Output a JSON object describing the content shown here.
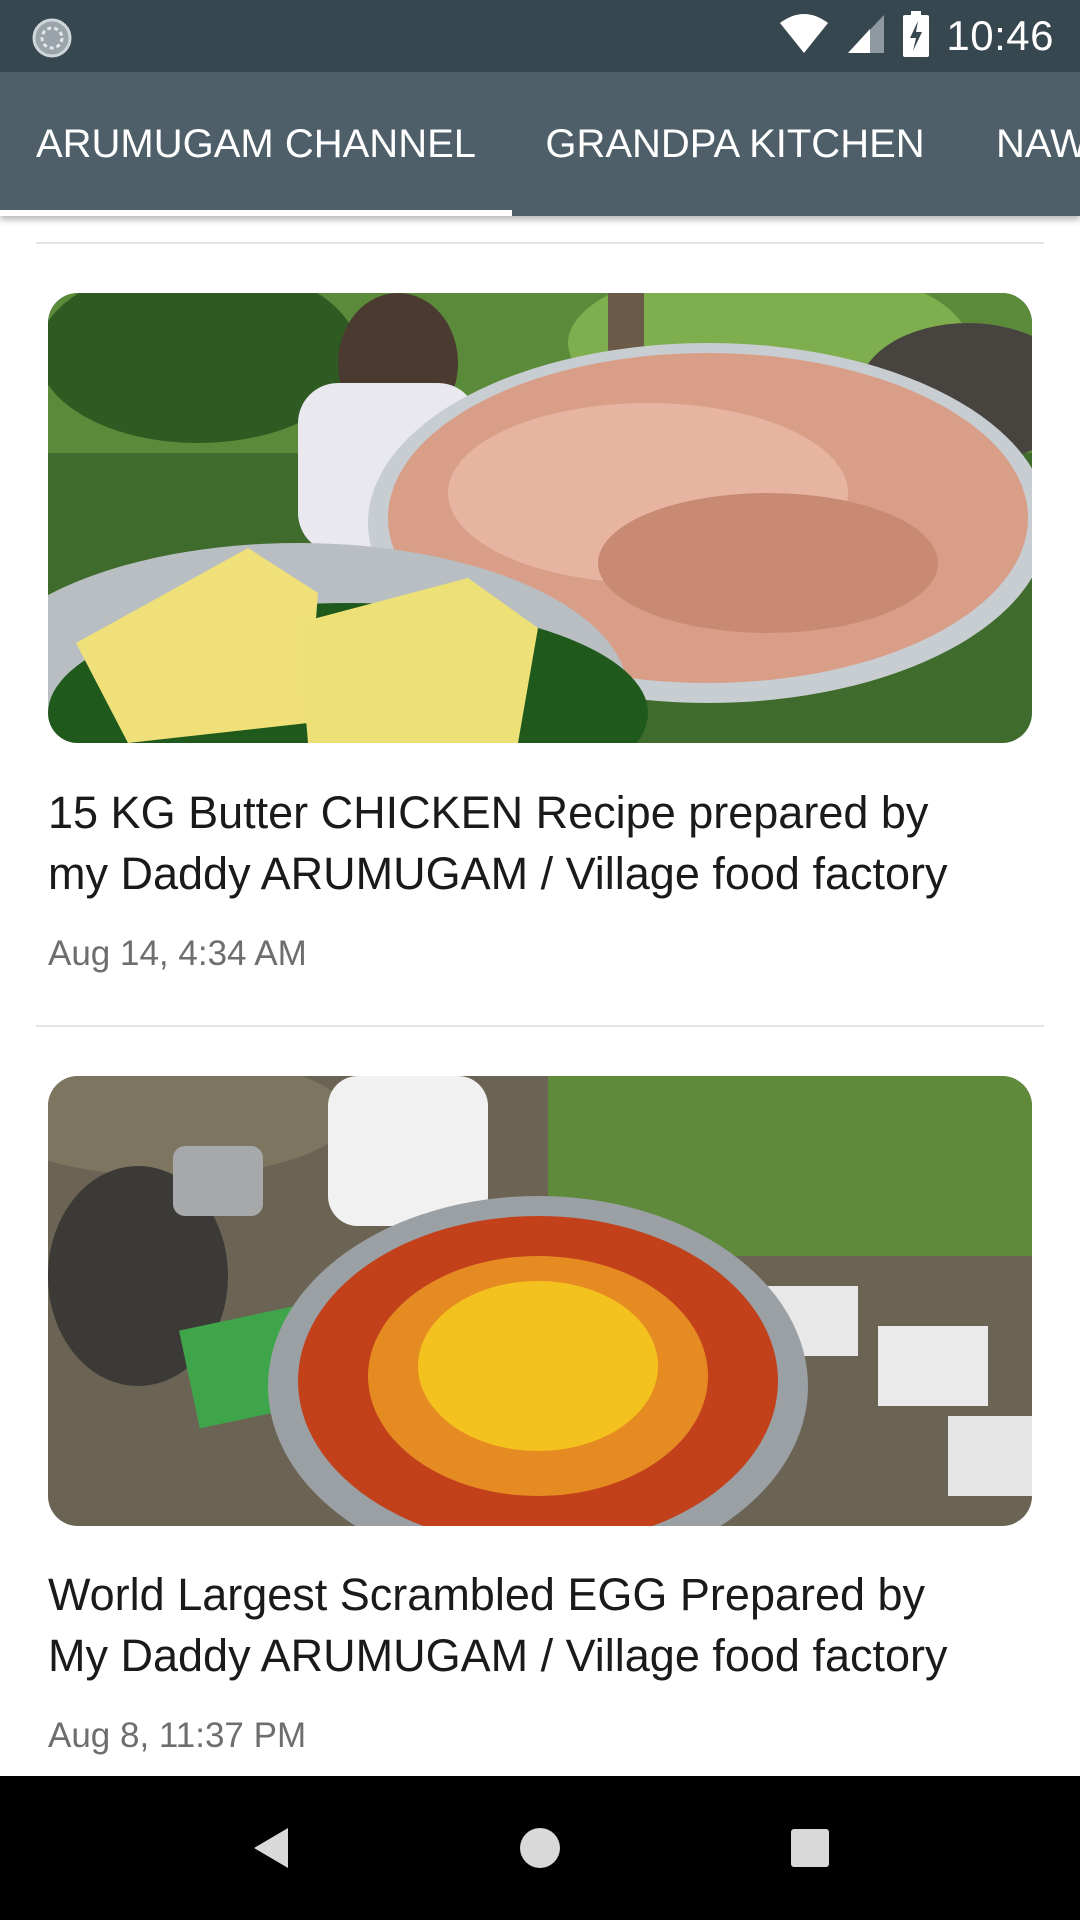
{
  "status_bar": {
    "time": "10:46",
    "icons": [
      "sync-icon",
      "wifi-icon",
      "cellular-signal-icon",
      "battery-charging-icon"
    ]
  },
  "tabs": [
    {
      "label": "ARUMUGAM CHANNEL",
      "selected": true
    },
    {
      "label": "GRANDPA KITCHEN",
      "selected": false
    },
    {
      "label": "NAW",
      "selected": false
    }
  ],
  "videos": [
    {
      "title_line1": "15 KG Butter CHICKEN Recipe prepared by",
      "title_line2": "my Daddy ARUMUGAM / Village food factory",
      "date": "Aug 14, 4:34 AM"
    },
    {
      "title_line1": "World Largest Scrambled EGG Prepared by",
      "title_line2": "My Daddy ARUMUGAM / Village food factory",
      "date": "Aug 8, 11:37 PM"
    }
  ],
  "nav_bar": {
    "icons": [
      "back-icon",
      "home-icon",
      "recents-icon"
    ]
  },
  "colors": {
    "status_bar": "#37474f",
    "tab_bar": "#4e5f69",
    "tab_indicator": "#ffffff",
    "title_text": "#1a1a1a",
    "date_text": "#6e6e6e"
  }
}
